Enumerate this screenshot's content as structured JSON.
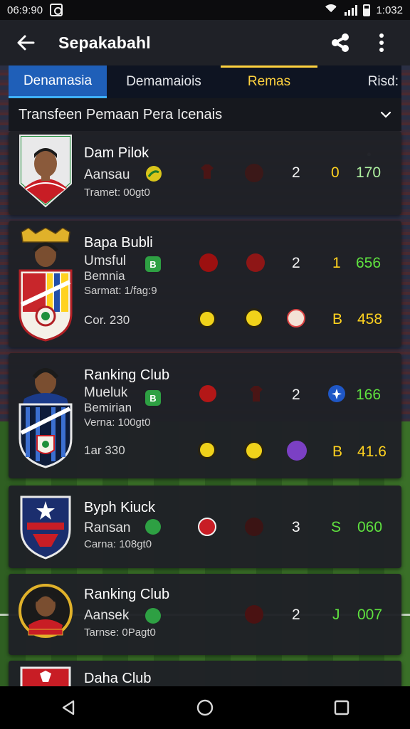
{
  "status": {
    "time_left": "06:9:90",
    "time_right": "1:032"
  },
  "appbar": {
    "title": "Sepakabahl"
  },
  "tabs": [
    {
      "label": "Denamasia"
    },
    {
      "label": "Demamaiois"
    },
    {
      "label": "Remas"
    },
    {
      "label": "Risd:"
    }
  ],
  "filter": {
    "label": "Transfeen Pemaan Pera Icenais"
  },
  "players": [
    {
      "name": "Dam Pilok",
      "club": "Aansau",
      "meta": "Tramet: 00gt0",
      "stats": [
        "2",
        "0",
        "170"
      ]
    },
    {
      "name": "Bapa Bubli",
      "club": "Umsful",
      "sub": "Bemnia",
      "meta": "Sarmat: 1/fag:9",
      "cost": "Cor. 230",
      "pos": "B",
      "stats": [
        "2",
        "1",
        "656"
      ],
      "stats2": [
        "B",
        "458"
      ]
    },
    {
      "name": "Ranking Club",
      "club": "Mueluk",
      "sub": "Bemirian",
      "meta": "Verna: 100gt0",
      "cost": "1ar 330",
      "pos": "B",
      "stats": [
        "2",
        "166"
      ],
      "stats2": [
        "B",
        "41.6"
      ]
    },
    {
      "name": "Byph Kiuck",
      "club": "Ransan",
      "meta": "Carna: 108gt0",
      "stats": [
        "3",
        "S",
        "060"
      ]
    },
    {
      "name": "Ranking Club",
      "club": "Aansek",
      "meta": "Tarnse: 0Pagt0",
      "stats": [
        "2",
        "J",
        "007"
      ]
    },
    {
      "name": "Daha Club"
    }
  ],
  "colors": {
    "accent_blue": "#1f5fb8",
    "yellow": "#ffd21f",
    "green": "#5fe23f",
    "card_bg": "#1f2127"
  }
}
